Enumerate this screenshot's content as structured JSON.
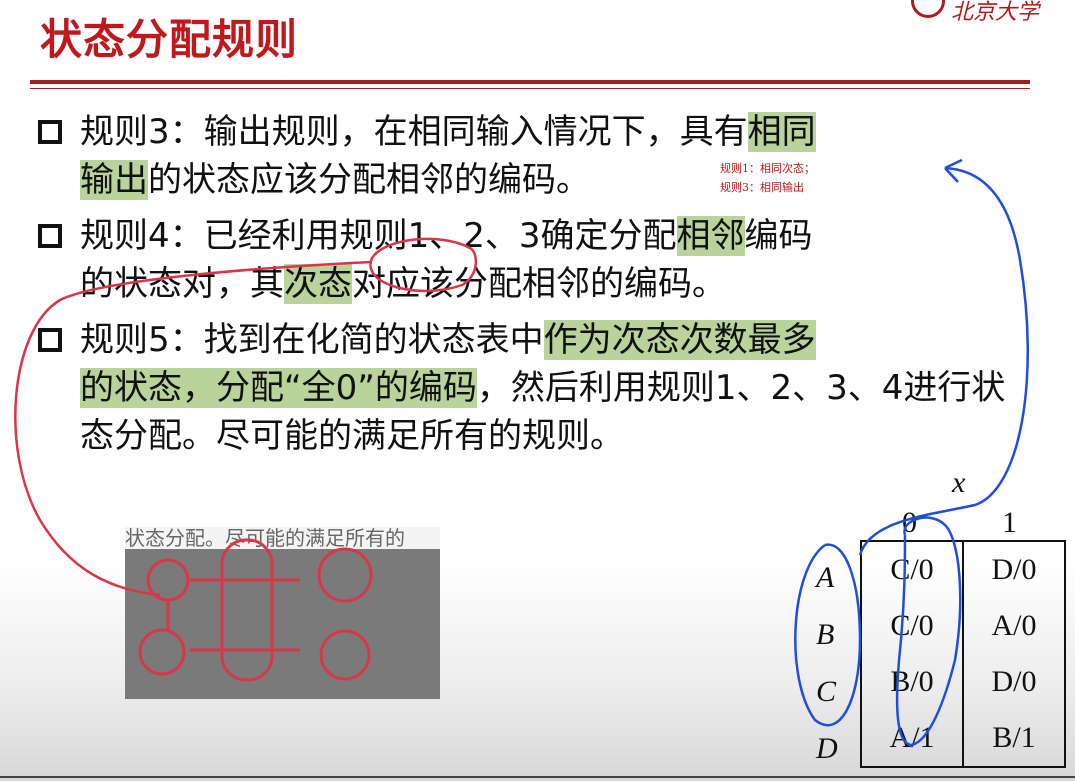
{
  "title": "状态分配规则",
  "logo_text": "北京大学",
  "rule3": {
    "a": "规则3：输出规则，在相同输入情况下，具有",
    "hl1": "相同",
    "hl2": "输出",
    "b": "的状态应该分配相邻的编码。"
  },
  "note": {
    "line1": "规则1：相同次态；",
    "line2": "规则3：相同输出"
  },
  "rule4": {
    "a": "规则4：已经利用规则1、2、3确定分配",
    "hl1": "相邻",
    "b": "编码",
    "c": "的状态对，其",
    "hl2": "次态",
    "d": "对应该分配相邻的编码。"
  },
  "rule5": {
    "a": "规则5：找到在化简的状态表中",
    "hl1": "作为次态次数最多",
    "hl2": "的状态，分配“全0”的编码",
    "b": "，然后利用规则1、2、3、4进行状态分配。尽可能的满足所有的规则。"
  },
  "video_caption": "状态分配。尽可能的满足所有的",
  "state_table": {
    "input_var": "x",
    "columns": [
      "0",
      "1"
    ],
    "rows": [
      {
        "state": "A",
        "c0": "C/0",
        "c1": "D/0"
      },
      {
        "state": "B",
        "c0": "C/0",
        "c1": "A/0"
      },
      {
        "state": "C",
        "c0": "B/0",
        "c1": "D/0"
      },
      {
        "state": "D",
        "c0": "A/1",
        "c1": "B/1"
      }
    ]
  },
  "colors": {
    "title": "#c0191d",
    "highlight": "#b9d39a",
    "ink_red": "#d9364a",
    "ink_blue": "#1f4fd6"
  }
}
